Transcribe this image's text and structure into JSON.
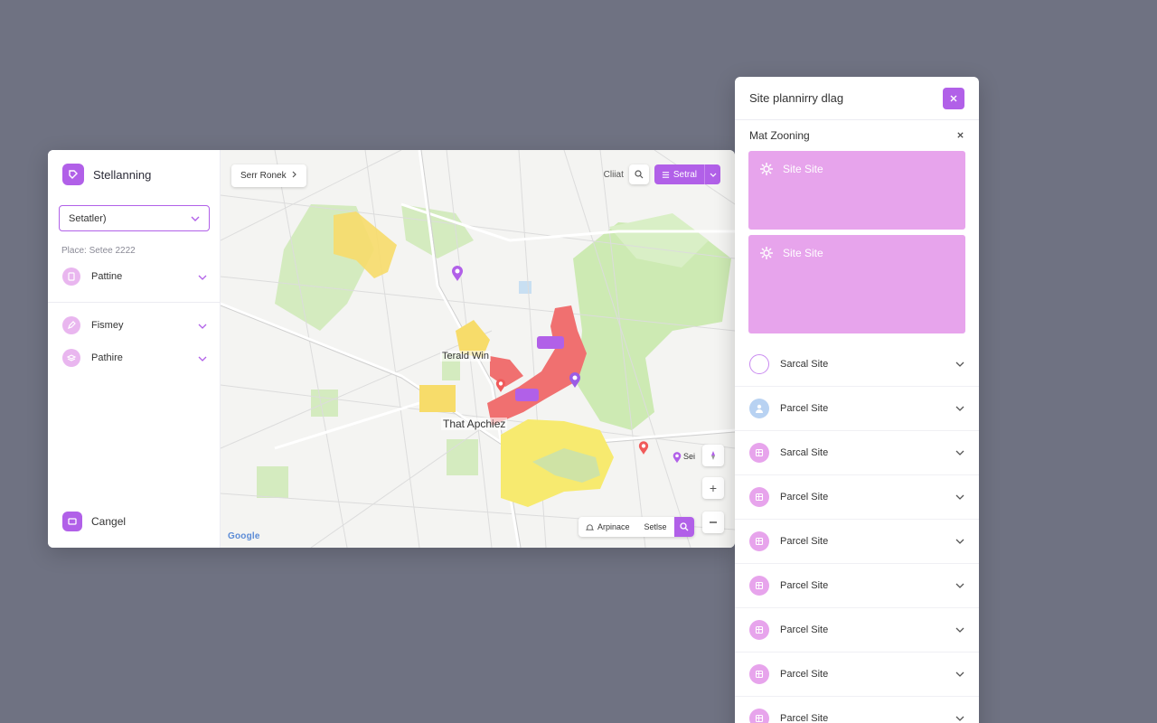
{
  "sidebar": {
    "brand_label": "Stellanning",
    "select_value": "Setatler)",
    "place_label": "Place: Setee 2222",
    "items": [
      {
        "label": "Pattine",
        "icon": "document-icon"
      },
      {
        "label": "Fismey",
        "icon": "pen-icon"
      },
      {
        "label": "Pathire",
        "icon": "layers-icon"
      }
    ],
    "cancel_label": "Cangel"
  },
  "map": {
    "route_button_label": "Serr Ronek",
    "top_right_text": "Cliiat",
    "search_button_label": "Setral",
    "labels": {
      "area_1": "Terald Win",
      "area_2": "That Apchiez",
      "site_marker": "Sei"
    },
    "bottom_bar": {
      "left_label": "Arpinace",
      "right_label": "Setlse"
    },
    "logo_text": "Google",
    "colors": {
      "yellow_zone": "#f7dc6a",
      "red_zone": "#f07070",
      "park": "#cfe9b8",
      "accent": "#b160e8"
    }
  },
  "panel": {
    "title": "Site plannirry dlag",
    "subheader": "Mat Zooning",
    "cards": [
      {
        "label": "Site Site",
        "icon": "gear-icon"
      },
      {
        "label": "Site Site",
        "icon": "gear-icon"
      }
    ],
    "list": [
      {
        "label": "Sarcal Site",
        "icon": "radio-icon"
      },
      {
        "label": "Parcel Site",
        "icon": "user-icon"
      },
      {
        "label": "Sarcal Site",
        "icon": "parcel-icon"
      },
      {
        "label": "Parcel Site",
        "icon": "parcel-icon"
      },
      {
        "label": "Parcel Site",
        "icon": "parcel-icon"
      },
      {
        "label": "Parcel Site",
        "icon": "parcel-icon"
      },
      {
        "label": "Parcel Site",
        "icon": "parcel-icon"
      },
      {
        "label": "Parcel Site",
        "icon": "parcel-icon"
      },
      {
        "label": "Parcel Site",
        "icon": "parcel-icon"
      }
    ]
  }
}
